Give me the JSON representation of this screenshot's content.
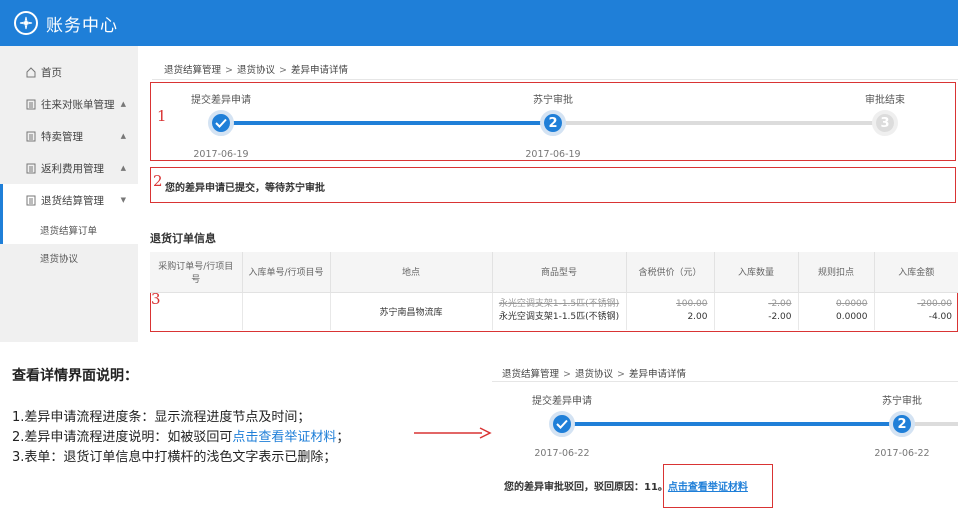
{
  "app": {
    "title": "账务中心",
    "logo_icon": "compass-icon",
    "brand_color": "#1f7fd8"
  },
  "sidebar": {
    "items": [
      {
        "label": "首页",
        "icon": "home-icon"
      },
      {
        "label": "往来对账单管理",
        "icon": "document-icon"
      },
      {
        "label": "特卖管理",
        "icon": "document-icon"
      },
      {
        "label": "返利费用管理",
        "icon": "document-icon"
      },
      {
        "label": "退货结算管理",
        "icon": "document-icon"
      }
    ],
    "subitems": [
      "退货结算订单",
      "退货协议"
    ]
  },
  "breadcrumb": [
    "退货结算管理",
    "退货协议",
    "差异申请详情"
  ],
  "box_labels": [
    "1",
    "2",
    "3"
  ],
  "progress": {
    "steps": [
      {
        "label": "提交差异申请",
        "date": "2017-06-19",
        "state": "done"
      },
      {
        "label": "苏宁审批",
        "date": "2017-06-19",
        "number": "2",
        "state": "current"
      },
      {
        "label": "审批结束",
        "date": "",
        "number": "3",
        "state": "todo"
      }
    ]
  },
  "status_message": "您的差异申请已提交，等待苏宁审批",
  "order_section": {
    "title": "退货订单信息",
    "columns": [
      "采购订单号/行项目号",
      "入库单号/行项目号",
      "地点",
      "商品型号",
      "含税供价（元）",
      "入库数量",
      "规则扣点",
      "入库金额"
    ],
    "row": {
      "po": "",
      "receipt": "",
      "location": "苏宁南昌物流库",
      "model_old": "永光空调支架1-1.5匹(不锈钢)",
      "model_new": "永光空调支架1-1.5匹(不锈钢)",
      "price_old": "100.00",
      "price_new": "2.00",
      "qty_old": "-2.00",
      "qty_new": "-2.00",
      "rate_old": "0.0000",
      "rate_new": "0.0000",
      "amount_old": "-200.00",
      "amount_new": "-4.00"
    }
  },
  "explain": {
    "title": "查看详情界面说明：",
    "line1": "1.差异申请流程进度条：显示流程进度节点及时间；",
    "line2_pre": "2.差异申请流程进度说明：如被驳回可",
    "line2_link": "点击查看举证材料",
    "line2_post": "；",
    "line3": "3.表单：退货订单信息中打横杆的浅色文字表示已删除；"
  },
  "inset": {
    "breadcrumb": [
      "退货结算管理",
      "退货协议",
      "差异申请详情"
    ],
    "steps": [
      {
        "label": "提交差异申请",
        "date": "2017-06-22"
      },
      {
        "label": "苏宁审批",
        "date": "2017-06-22",
        "number": "2"
      }
    ],
    "reject_text": "您的差异审批驳回，驳回原因：11。",
    "reject_link": "点击查看举证材料"
  }
}
